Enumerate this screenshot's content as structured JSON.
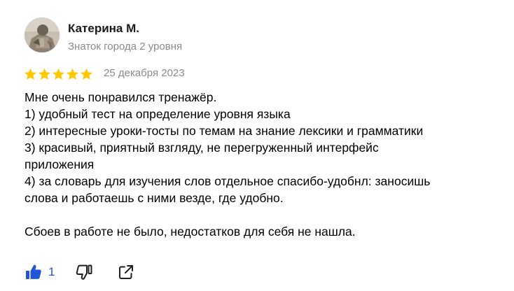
{
  "review": {
    "author": {
      "name": "Катерина М.",
      "level": "Знаток города 2 уровня",
      "avatar_icon": "avatar-photo"
    },
    "rating": {
      "value": 5,
      "max": 5,
      "star_color": "#FFC800"
    },
    "date": "25 декабря 2023",
    "text_lines": [
      "Мне очень понравился тренажёр.",
      "1) удобный тест на определение уровня языка",
      "2) интересные уроки-тосты по темам на знание лексики и грамматики",
      "3) красивый, приятный взгляду, не перегруженный интерфейс",
      "приложения",
      "4) за словарь для изучения слов отдельное спасибо-удобнл: заносишь",
      "слова и работаешь с ними везде, где удобно.",
      "",
      "Сбоев в работе не было, недостатков для себя не нашла."
    ],
    "actions": {
      "like_icon": "thumbs-up-icon",
      "like_count": "1",
      "dislike_icon": "thumbs-down-icon",
      "share_icon": "share-icon"
    }
  },
  "colors": {
    "accent": "#2255D8",
    "secondary_text": "#8A8A8A",
    "star": "#FFC800"
  }
}
